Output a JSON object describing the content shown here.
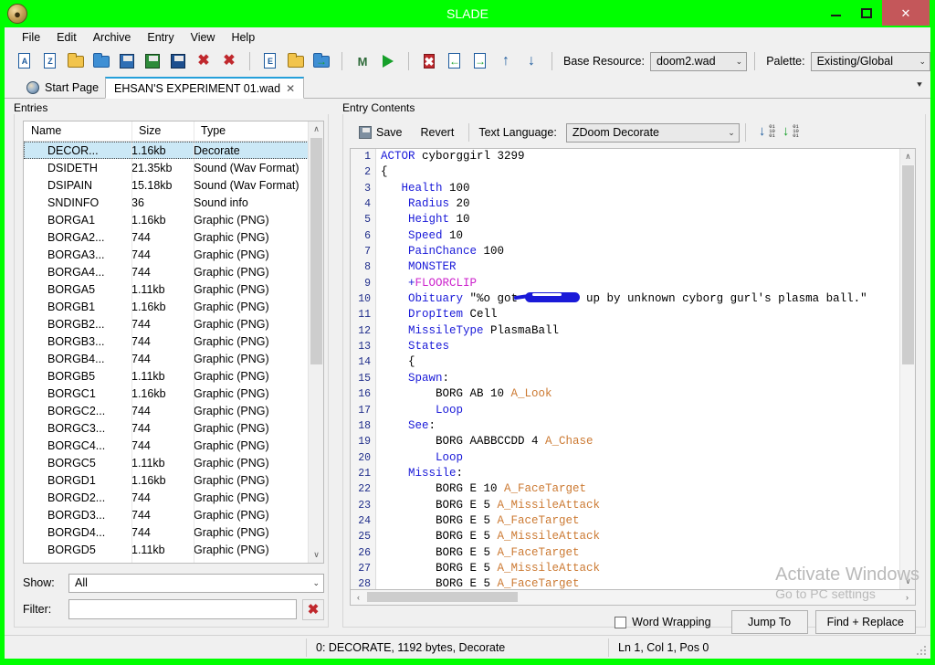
{
  "window": {
    "title": "SLADE",
    "accent_color": "#00ff00",
    "close_button_color": "#c4575a",
    "minimize_label": "–",
    "maximize_label": "□",
    "close_label": "✕"
  },
  "menubar": {
    "items": [
      {
        "label": "File"
      },
      {
        "label": "Edit"
      },
      {
        "label": "Archive"
      },
      {
        "label": "Entry"
      },
      {
        "label": "View"
      },
      {
        "label": "Help"
      }
    ]
  },
  "toolbar": {
    "icons": [
      {
        "name": "new-archive-icon",
        "glyph": "A"
      },
      {
        "name": "new-entry-icon",
        "glyph": "Z"
      },
      {
        "name": "open-archive-icon",
        "glyph": ""
      },
      {
        "name": "open-folder-icon",
        "glyph": ""
      },
      {
        "name": "save-icon",
        "glyph": ""
      },
      {
        "name": "save-as-icon",
        "glyph": ""
      },
      {
        "name": "save-all-icon",
        "glyph": ""
      },
      {
        "name": "close-archive-icon",
        "glyph": "✖"
      },
      {
        "name": "close-all-icon",
        "glyph": "✖"
      },
      {
        "name": "new-text-entry-icon",
        "glyph": "E"
      },
      {
        "name": "new-directory-icon",
        "glyph": ""
      },
      {
        "name": "import-files-icon",
        "glyph": ""
      },
      {
        "name": "maps-icon",
        "glyph": "M"
      },
      {
        "name": "run-map-icon",
        "glyph": "▶"
      },
      {
        "name": "delete-entry-icon",
        "glyph": ""
      },
      {
        "name": "import-entry-icon",
        "glyph": ""
      },
      {
        "name": "export-entry-icon",
        "glyph": ""
      },
      {
        "name": "move-up-icon",
        "glyph": "↑"
      },
      {
        "name": "move-down-icon",
        "glyph": "↓"
      }
    ],
    "base_resource_label": "Base Resource:",
    "base_resource_value": "doom2.wad",
    "palette_label": "Palette:",
    "palette_value": "Existing/Global",
    "caret": "⌄"
  },
  "tabs": [
    {
      "label": "Start Page",
      "close": "✕",
      "active": false,
      "has_icon": true
    },
    {
      "label": "EHSAN'S EXPERIMENT 01.wad",
      "close": "✕",
      "active": true,
      "has_icon": false
    }
  ],
  "tabbar": {
    "overflow_caret": "⯆"
  },
  "entries_panel": {
    "title": "Entries",
    "columns": [
      "Name",
      "Size",
      "Type"
    ],
    "rows": [
      {
        "name": "DECOR...",
        "size": "1.16kb",
        "type": "Decorate",
        "selected": true
      },
      {
        "name": "DSIDETH",
        "size": "21.35kb",
        "type": "Sound (Wav Format)",
        "selected": false
      },
      {
        "name": "DSIPAIN",
        "size": "15.18kb",
        "type": "Sound (Wav Format)",
        "selected": false
      },
      {
        "name": "SNDINFO",
        "size": "36",
        "type": "Sound info",
        "selected": false
      },
      {
        "name": "BORGA1",
        "size": "1.16kb",
        "type": "Graphic (PNG)",
        "selected": false
      },
      {
        "name": "BORGA2...",
        "size": "744",
        "type": "Graphic (PNG)",
        "selected": false
      },
      {
        "name": "BORGA3...",
        "size": "744",
        "type": "Graphic (PNG)",
        "selected": false
      },
      {
        "name": "BORGA4...",
        "size": "744",
        "type": "Graphic (PNG)",
        "selected": false
      },
      {
        "name": "BORGA5",
        "size": "1.11kb",
        "type": "Graphic (PNG)",
        "selected": false
      },
      {
        "name": "BORGB1",
        "size": "1.16kb",
        "type": "Graphic (PNG)",
        "selected": false
      },
      {
        "name": "BORGB2...",
        "size": "744",
        "type": "Graphic (PNG)",
        "selected": false
      },
      {
        "name": "BORGB3...",
        "size": "744",
        "type": "Graphic (PNG)",
        "selected": false
      },
      {
        "name": "BORGB4...",
        "size": "744",
        "type": "Graphic (PNG)",
        "selected": false
      },
      {
        "name": "BORGB5",
        "size": "1.11kb",
        "type": "Graphic (PNG)",
        "selected": false
      },
      {
        "name": "BORGC1",
        "size": "1.16kb",
        "type": "Graphic (PNG)",
        "selected": false
      },
      {
        "name": "BORGC2...",
        "size": "744",
        "type": "Graphic (PNG)",
        "selected": false
      },
      {
        "name": "BORGC3...",
        "size": "744",
        "type": "Graphic (PNG)",
        "selected": false
      },
      {
        "name": "BORGC4...",
        "size": "744",
        "type": "Graphic (PNG)",
        "selected": false
      },
      {
        "name": "BORGC5",
        "size": "1.11kb",
        "type": "Graphic (PNG)",
        "selected": false
      },
      {
        "name": "BORGD1",
        "size": "1.16kb",
        "type": "Graphic (PNG)",
        "selected": false
      },
      {
        "name": "BORGD2...",
        "size": "744",
        "type": "Graphic (PNG)",
        "selected": false
      },
      {
        "name": "BORGD3...",
        "size": "744",
        "type": "Graphic (PNG)",
        "selected": false
      },
      {
        "name": "BORGD4...",
        "size": "744",
        "type": "Graphic (PNG)",
        "selected": false
      },
      {
        "name": "BORGD5",
        "size": "1.11kb",
        "type": "Graphic (PNG)",
        "selected": false
      }
    ],
    "show_label": "Show:",
    "show_value": "All",
    "filter_label": "Filter:",
    "filter_value": "",
    "filter_placeholder": "",
    "clear_glyph": "✖",
    "scroll_up_glyph": "∧",
    "scroll_down_glyph": "∨",
    "caret": "⌄"
  },
  "contents_panel": {
    "title": "Entry Contents",
    "save_label": "Save",
    "revert_label": "Revert",
    "text_language_label": "Text Language:",
    "text_language_value": "ZDoom Decorate",
    "caret": "⌄",
    "word_wrapping_label": "Word Wrapping",
    "word_wrapping_checked": false,
    "jump_to_label": "Jump To",
    "find_replace_label": "Find + Replace",
    "scroll_up_glyph": "∧",
    "scroll_down_glyph": "∨",
    "scroll_left_glyph": "‹",
    "scroll_right_glyph": "›"
  },
  "code": {
    "language": "ZDoom Decorate",
    "lines": [
      {
        "n": 1,
        "tokens": [
          {
            "t": "ACTOR",
            "c": "kw"
          },
          {
            "t": " cyborggirl 3299",
            "c": "plain"
          }
        ]
      },
      {
        "n": 2,
        "tokens": [
          {
            "t": "{",
            "c": "plain"
          }
        ]
      },
      {
        "n": 3,
        "tokens": [
          {
            "t": "   ",
            "c": "plain"
          },
          {
            "t": "Health",
            "c": "kw"
          },
          {
            "t": " 100",
            "c": "plain"
          }
        ]
      },
      {
        "n": 4,
        "tokens": [
          {
            "t": "    ",
            "c": "plain"
          },
          {
            "t": "Radius",
            "c": "kw"
          },
          {
            "t": " 20",
            "c": "plain"
          }
        ]
      },
      {
        "n": 5,
        "tokens": [
          {
            "t": "    ",
            "c": "plain"
          },
          {
            "t": "Height",
            "c": "kw"
          },
          {
            "t": " 10",
            "c": "plain"
          }
        ]
      },
      {
        "n": 6,
        "tokens": [
          {
            "t": "    ",
            "c": "plain"
          },
          {
            "t": "Speed",
            "c": "kw"
          },
          {
            "t": " 10",
            "c": "plain"
          }
        ]
      },
      {
        "n": 7,
        "tokens": [
          {
            "t": "    ",
            "c": "plain"
          },
          {
            "t": "PainChance",
            "c": "kw"
          },
          {
            "t": " 100",
            "c": "plain"
          }
        ]
      },
      {
        "n": 8,
        "tokens": [
          {
            "t": "    ",
            "c": "plain"
          },
          {
            "t": "MONSTER",
            "c": "kw"
          }
        ]
      },
      {
        "n": 9,
        "tokens": [
          {
            "t": "    ",
            "c": "plain"
          },
          {
            "t": "+",
            "c": "kw"
          },
          {
            "t": "FLOORCLIP",
            "c": "flag"
          }
        ]
      },
      {
        "n": 10,
        "tokens": [
          {
            "t": "    ",
            "c": "plain"
          },
          {
            "t": "Obituary",
            "c": "kw"
          },
          {
            "t": " \"%o got ",
            "c": "plain"
          },
          {
            "t": "",
            "c": "redact"
          },
          {
            "t": " up by unknown cyborg gurl's plasma ball.\"",
            "c": "plain"
          }
        ]
      },
      {
        "n": 11,
        "tokens": [
          {
            "t": "    ",
            "c": "plain"
          },
          {
            "t": "DropItem",
            "c": "kw"
          },
          {
            "t": " Cell",
            "c": "plain"
          }
        ]
      },
      {
        "n": 12,
        "tokens": [
          {
            "t": "    ",
            "c": "plain"
          },
          {
            "t": "MissileType",
            "c": "kw"
          },
          {
            "t": " PlasmaBall",
            "c": "plain"
          }
        ]
      },
      {
        "n": 13,
        "tokens": [
          {
            "t": "    ",
            "c": "plain"
          },
          {
            "t": "States",
            "c": "kw"
          }
        ]
      },
      {
        "n": 14,
        "tokens": [
          {
            "t": "    {",
            "c": "plain"
          }
        ]
      },
      {
        "n": 15,
        "tokens": [
          {
            "t": "    ",
            "c": "plain"
          },
          {
            "t": "Spawn",
            "c": "kw"
          },
          {
            "t": ":",
            "c": "plain"
          }
        ]
      },
      {
        "n": 16,
        "tokens": [
          {
            "t": "        BORG AB 10 ",
            "c": "plain"
          },
          {
            "t": "A_Look",
            "c": "fn"
          }
        ]
      },
      {
        "n": 17,
        "tokens": [
          {
            "t": "        ",
            "c": "plain"
          },
          {
            "t": "Loop",
            "c": "kw"
          }
        ]
      },
      {
        "n": 18,
        "tokens": [
          {
            "t": "    ",
            "c": "plain"
          },
          {
            "t": "See",
            "c": "kw"
          },
          {
            "t": ":",
            "c": "plain"
          }
        ]
      },
      {
        "n": 19,
        "tokens": [
          {
            "t": "        BORG AABBCCDD 4 ",
            "c": "plain"
          },
          {
            "t": "A_Chase",
            "c": "fn"
          }
        ]
      },
      {
        "n": 20,
        "tokens": [
          {
            "t": "        ",
            "c": "plain"
          },
          {
            "t": "Loop",
            "c": "kw"
          }
        ]
      },
      {
        "n": 21,
        "tokens": [
          {
            "t": "    ",
            "c": "plain"
          },
          {
            "t": "Missile",
            "c": "kw"
          },
          {
            "t": ":",
            "c": "plain"
          }
        ]
      },
      {
        "n": 22,
        "tokens": [
          {
            "t": "        BORG E 10 ",
            "c": "plain"
          },
          {
            "t": "A_FaceTarget",
            "c": "fn"
          }
        ]
      },
      {
        "n": 23,
        "tokens": [
          {
            "t": "        BORG E 5 ",
            "c": "plain"
          },
          {
            "t": "A_MissileAttack",
            "c": "fn"
          }
        ]
      },
      {
        "n": 24,
        "tokens": [
          {
            "t": "        BORG E 5 ",
            "c": "plain"
          },
          {
            "t": "A_FaceTarget",
            "c": "fn"
          }
        ]
      },
      {
        "n": 25,
        "tokens": [
          {
            "t": "        BORG E 5 ",
            "c": "plain"
          },
          {
            "t": "A_MissileAttack",
            "c": "fn"
          }
        ]
      },
      {
        "n": 26,
        "tokens": [
          {
            "t": "        BORG E 5 ",
            "c": "plain"
          },
          {
            "t": "A_FaceTarget",
            "c": "fn"
          }
        ]
      },
      {
        "n": 27,
        "tokens": [
          {
            "t": "        BORG E 5 ",
            "c": "plain"
          },
          {
            "t": "A_MissileAttack",
            "c": "fn"
          }
        ]
      },
      {
        "n": 28,
        "tokens": [
          {
            "t": "        BORG E 5 ",
            "c": "plain"
          },
          {
            "t": "A_FaceTarget",
            "c": "fn"
          }
        ]
      }
    ]
  },
  "statusbar": {
    "left": "",
    "entry_info": "0: DECORATE, 1192 bytes, Decorate",
    "cursor_info": "Ln 1, Col 1, Pos 0"
  },
  "watermark": {
    "line1": "Activate Windows",
    "line2": "Go to PC settings"
  }
}
